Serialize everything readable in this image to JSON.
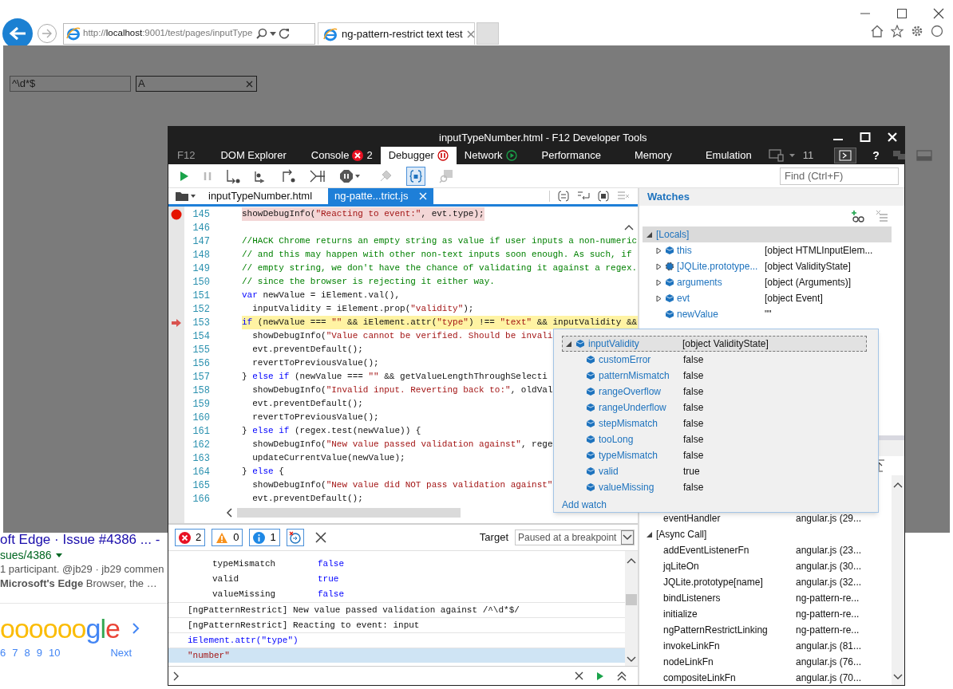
{
  "browser": {
    "address": {
      "scheme": "http://",
      "host": "localhost",
      "rest": ":9001/test/pages/inputType"
    },
    "tab": {
      "title": "ng-pattern-restrict text test",
      "selected": true
    }
  },
  "page": {
    "fields": [
      {
        "value": "^\\d*$",
        "focused": false
      },
      {
        "value": "A",
        "focused": true
      }
    ]
  },
  "background_result": {
    "title": "oft Edge · Issue #4386 ... -",
    "url": "sues/4386",
    "meta": "1 participant. @jb29 · jb29 commen",
    "snippet": "**Microsoft's Edge** Browser, the  …"
  },
  "pagination": {
    "logo": "oooooogle",
    "pages": [
      "6",
      "7",
      "8",
      "9",
      "10"
    ],
    "next": "Next"
  },
  "devtools": {
    "title": "inputTypeNumber.html - F12 Developer Tools",
    "f12": "F12",
    "tabs": [
      {
        "label": "DOM Explorer",
        "selected": false,
        "kind": "plain"
      },
      {
        "label": "Console",
        "selected": false,
        "kind": "errors",
        "badge": "2"
      },
      {
        "label": "Debugger",
        "selected": true,
        "kind": "paused"
      },
      {
        "label": "Network",
        "selected": false,
        "kind": "recording"
      },
      {
        "label": "Performance",
        "selected": false,
        "kind": "plain"
      },
      {
        "label": "Memory",
        "selected": false,
        "kind": "plain"
      },
      {
        "label": "Emulation",
        "selected": false,
        "kind": "plain"
      }
    ],
    "document_mode": "11",
    "help": "?",
    "find_placeholder": "Find (Ctrl+F)",
    "files": [
      {
        "name": "inputTypeNumber.html",
        "selected": false
      },
      {
        "name": "ng-patte...trict.js",
        "selected": true
      }
    ],
    "code_lines": [
      {
        "number": "145",
        "breakpoint": true,
        "current": false,
        "tokens": [
          {
            "kind": "plain",
            "text": "showDebugInfo("
          },
          {
            "kind": "string",
            "text": "\"Reacting to event:\""
          },
          {
            "kind": "plain",
            "text": ", evt.type);"
          }
        ]
      },
      {
        "number": "146",
        "breakpoint": false,
        "current": false
      },
      {
        "number": "147",
        "breakpoint": false,
        "current": false,
        "tokens": [
          {
            "kind": "comment",
            "text": "//HACK Chrome returns an empty string as value if user inputs a non-numeric"
          }
        ]
      },
      {
        "number": "148",
        "breakpoint": false,
        "current": false,
        "tokens": [
          {
            "kind": "comment",
            "text": "// and this may happen with other non-text inputs soon enough. As such, if"
          }
        ]
      },
      {
        "number": "149",
        "breakpoint": false,
        "current": false,
        "tokens": [
          {
            "kind": "comment",
            "text": "// empty string, we don't have the chance of validating it against a regex."
          }
        ]
      },
      {
        "number": "150",
        "breakpoint": false,
        "current": false,
        "tokens": [
          {
            "kind": "comment",
            "text": "// since the browser is rejecting it either way."
          }
        ]
      },
      {
        "number": "151",
        "breakpoint": false,
        "current": false,
        "tokens": [
          {
            "kind": "keyword",
            "text": "var"
          },
          {
            "kind": "plain",
            "text": " newValue = iElement.val(),"
          }
        ]
      },
      {
        "number": "152",
        "breakpoint": false,
        "current": false,
        "tokens": [
          {
            "kind": "plain",
            "text": "  inputValidity = iElement.prop("
          },
          {
            "kind": "string",
            "text": "\"validity\""
          },
          {
            "kind": "plain",
            "text": ");"
          }
        ]
      },
      {
        "number": "153",
        "breakpoint": false,
        "current": true,
        "tokens": [
          {
            "kind": "keyword",
            "text": "if"
          },
          {
            "kind": "plain",
            "text": " (newValue === "
          },
          {
            "kind": "string",
            "text": "\"\""
          },
          {
            "kind": "plain",
            "text": " && iElement.attr("
          },
          {
            "kind": "string",
            "text": "\"type\""
          },
          {
            "kind": "plain",
            "text": ") !== "
          },
          {
            "kind": "string",
            "text": "\"text\""
          },
          {
            "kind": "plain",
            "text": " && inputValidity &&"
          }
        ]
      },
      {
        "number": "154",
        "breakpoint": false,
        "current": false,
        "tokens": [
          {
            "kind": "plain",
            "text": "  showDebugInfo("
          },
          {
            "kind": "string",
            "text": "\"Value cannot be verified. Should be invali"
          }
        ]
      },
      {
        "number": "155",
        "breakpoint": false,
        "current": false,
        "tokens": [
          {
            "kind": "plain",
            "text": "  evt.preventDefault();"
          }
        ]
      },
      {
        "number": "156",
        "breakpoint": false,
        "current": false,
        "tokens": [
          {
            "kind": "plain",
            "text": "  revertToPreviousValue();"
          }
        ]
      },
      {
        "number": "157",
        "breakpoint": false,
        "current": false,
        "tokens": [
          {
            "kind": "plain",
            "text": "} "
          },
          {
            "kind": "keyword",
            "text": "else if"
          },
          {
            "kind": "plain",
            "text": " (newValue === "
          },
          {
            "kind": "string",
            "text": "\"\""
          },
          {
            "kind": "plain",
            "text": " && getValueLengthThroughSelecti"
          }
        ]
      },
      {
        "number": "158",
        "breakpoint": false,
        "current": false,
        "tokens": [
          {
            "kind": "plain",
            "text": "  showDebugInfo("
          },
          {
            "kind": "string",
            "text": "\"Invalid input. Reverting back to:\""
          },
          {
            "kind": "plain",
            "text": ", oldVal"
          }
        ]
      },
      {
        "number": "159",
        "breakpoint": false,
        "current": false,
        "tokens": [
          {
            "kind": "plain",
            "text": "  evt.preventDefault();"
          }
        ]
      },
      {
        "number": "160",
        "breakpoint": false,
        "current": false,
        "tokens": [
          {
            "kind": "plain",
            "text": "  revertToPreviousValue();"
          }
        ]
      },
      {
        "number": "161",
        "breakpoint": false,
        "current": false,
        "tokens": [
          {
            "kind": "plain",
            "text": "} "
          },
          {
            "kind": "keyword",
            "text": "else if"
          },
          {
            "kind": "plain",
            "text": " (regex.test(newValue)) {"
          }
        ]
      },
      {
        "number": "162",
        "breakpoint": false,
        "current": false,
        "tokens": [
          {
            "kind": "plain",
            "text": "  showDebugInfo("
          },
          {
            "kind": "string",
            "text": "\"New value passed validation against\""
          },
          {
            "kind": "plain",
            "text": ", rege"
          }
        ]
      },
      {
        "number": "163",
        "breakpoint": false,
        "current": false,
        "tokens": [
          {
            "kind": "plain",
            "text": "  updateCurrentValue(newValue);"
          }
        ]
      },
      {
        "number": "164",
        "breakpoint": false,
        "current": false,
        "tokens": [
          {
            "kind": "plain",
            "text": "} "
          },
          {
            "kind": "keyword",
            "text": "else"
          },
          {
            "kind": "plain",
            "text": " {"
          }
        ]
      },
      {
        "number": "165",
        "breakpoint": false,
        "current": false,
        "tokens": [
          {
            "kind": "plain",
            "text": "  showDebugInfo("
          },
          {
            "kind": "string",
            "text": "\"New value did NOT pass validation against\""
          }
        ]
      },
      {
        "number": "166",
        "breakpoint": false,
        "current": false,
        "tokens": [
          {
            "kind": "plain",
            "text": "  evt.preventDefault();"
          }
        ]
      }
    ],
    "watches": {
      "title": "Watches",
      "locals": {
        "label": "[Locals]",
        "expanded": true,
        "items": [
          {
            "name": "this",
            "value": "[object HTMLInputElem...",
            "expandable": true,
            "kind": "object"
          },
          {
            "name": "[JQLite.prototype...",
            "value": "[object ValidityState]",
            "expandable": true,
            "kind": "prototype"
          },
          {
            "name": "arguments",
            "value": "[object (Arguments)]",
            "expandable": true,
            "kind": "object"
          },
          {
            "name": "evt",
            "value": "[object Event]",
            "expandable": true,
            "kind": "object"
          },
          {
            "name": "newValue",
            "value": "\"\"",
            "expandable": false,
            "kind": "object"
          }
        ]
      }
    },
    "datatip": {
      "name": "inputValidity",
      "value": "[object ValidityState]",
      "expanded": true,
      "children": [
        {
          "name": "customError",
          "value": "false"
        },
        {
          "name": "patternMismatch",
          "value": "false"
        },
        {
          "name": "rangeOverflow",
          "value": "false"
        },
        {
          "name": "rangeUnderflow",
          "value": "false"
        },
        {
          "name": "stepMismatch",
          "value": "false"
        },
        {
          "name": "tooLong",
          "value": "false"
        },
        {
          "name": "typeMismatch",
          "value": "false"
        },
        {
          "name": "valid",
          "value": "true"
        },
        {
          "name": "valueMissing",
          "value": "false"
        }
      ],
      "add_watch": "Add watch"
    },
    "call_stack": {
      "items": [
        {
          "name": "eventHandler",
          "location": "angular.js (29..."
        }
      ],
      "async": {
        "label": "[Async Call]",
        "expanded": true,
        "items": [
          {
            "name": "addEventListenerFn",
            "location": "angular.js (23..."
          },
          {
            "name": "jqLiteOn",
            "location": "angular.js (30..."
          },
          {
            "name": "JQLite.prototype[name]",
            "location": "angular.js (32..."
          },
          {
            "name": "bindListeners",
            "location": "ng-pattern-re..."
          },
          {
            "name": "initialize",
            "location": "ng-pattern-re..."
          },
          {
            "name": "ngPatternRestrictLinking",
            "location": "ng-pattern-re..."
          },
          {
            "name": "invokeLinkFn",
            "location": "angular.js (81..."
          },
          {
            "name": "nodeLinkFn",
            "location": "angular.js (76..."
          },
          {
            "name": "compositeLinkFn",
            "location": "angular.js (70..."
          }
        ]
      }
    },
    "console": {
      "counts": {
        "errors": "2",
        "warnings": "0",
        "info": "1"
      },
      "target_label": "Target",
      "target": "Paused at a breakpoint",
      "lines": [
        {
          "kind": "property",
          "name": "typeMismatch",
          "value": "false",
          "selected": false
        },
        {
          "kind": "property",
          "name": "valid",
          "value": "true",
          "selected": false
        },
        {
          "kind": "property",
          "name": "valueMissing",
          "value": "false",
          "selected": false
        },
        {
          "kind": "log",
          "text": "[ngPatternRestrict] New value passed validation against /^\\d*$/",
          "selected": false
        },
        {
          "kind": "log",
          "text": "[ngPatternRestrict] Reacting to event: input",
          "selected": false
        },
        {
          "kind": "input",
          "text": "iElement.attr(\"type\")",
          "selected": false
        },
        {
          "kind": "result",
          "text": "\"number\"",
          "selected": true
        }
      ]
    }
  }
}
